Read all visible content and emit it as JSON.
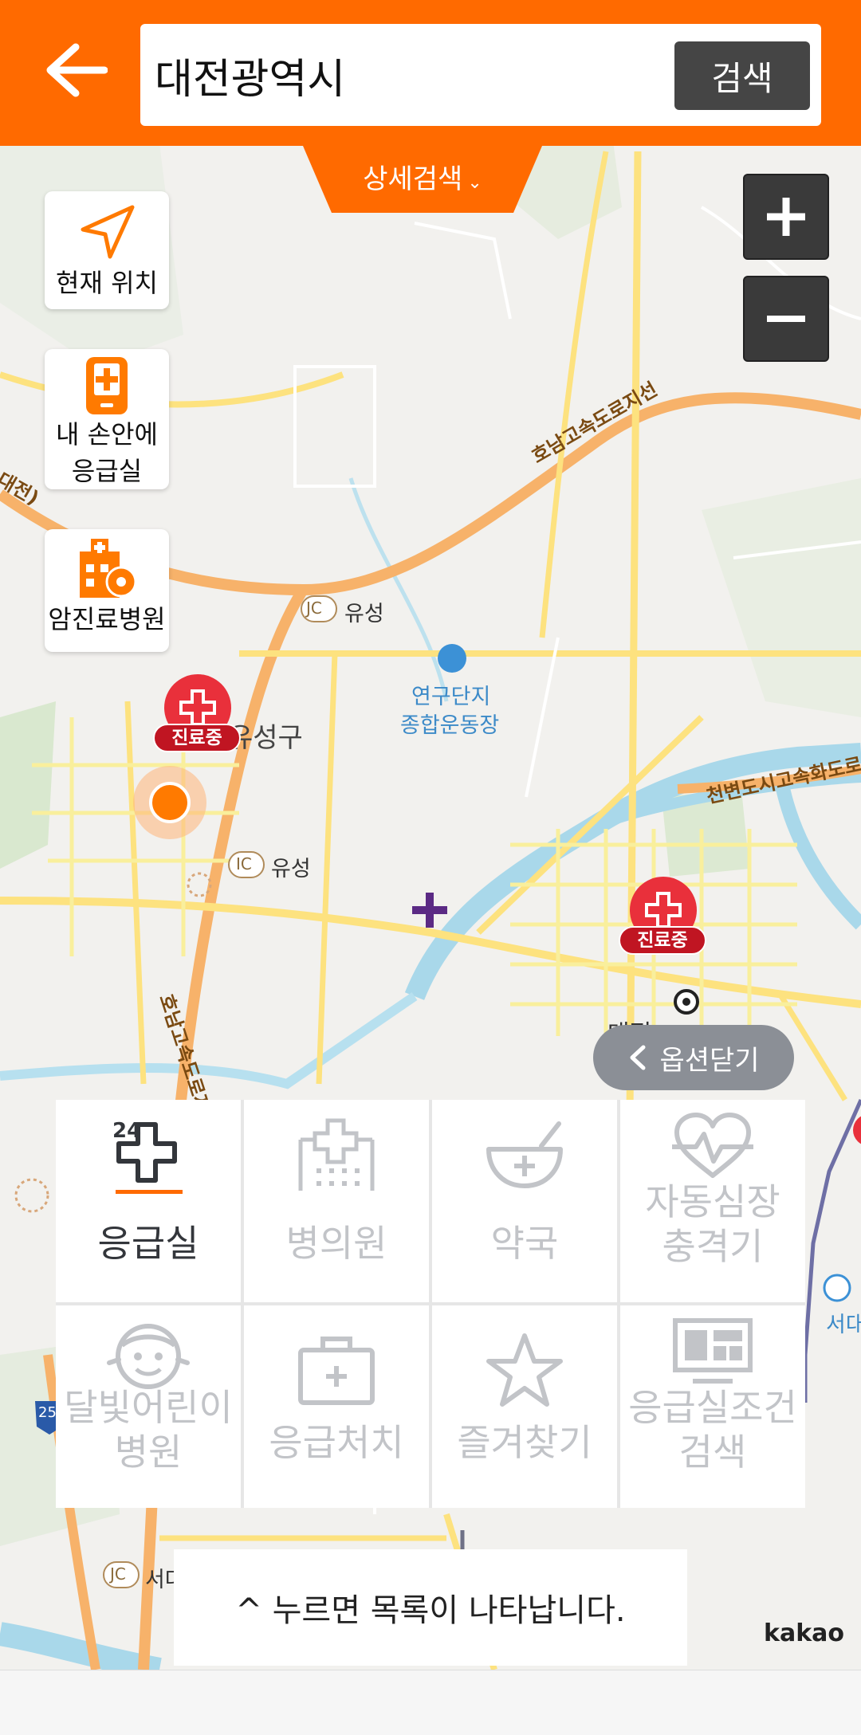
{
  "header": {
    "search_value": "대전광역시",
    "search_button": "검색",
    "detail_search": "상세검색"
  },
  "colors": {
    "brand": "#ff6a00",
    "marker": "#e9303b",
    "marker_badge": "#c01522",
    "grey_text": "#c2c4c8"
  },
  "left_buttons": {
    "current_location": "현재 위치",
    "er_in_hand_line1": "내 손안에",
    "er_in_hand_line2": "응급실",
    "cancer_hospital": "암진료병원"
  },
  "map_labels": {
    "jc_yuseong": "유성",
    "ic_yuseong": "유성",
    "yuseong_gu": "유성구",
    "sports_line1": "연구단지",
    "sports_line2": "종합운동장",
    "honam_branch": "호남고속도로지선",
    "cheonbyeon": "천변도시고속화도로",
    "honam_vertical": "호남고속도로지선",
    "left_edge": "대전)",
    "daejeon_station": "대전",
    "west_daejeon": "서대전",
    "jc_bottom": "서대",
    "jc_badge": "JC",
    "ic_badge": "IC",
    "highway_num": "25"
  },
  "markers": [
    {
      "status": "진료중"
    },
    {
      "status": "진료중"
    }
  ],
  "options_close": "옵션닫기",
  "categories": [
    {
      "label": "응급실",
      "active": true,
      "icon": "er-24-cross-icon"
    },
    {
      "label": "병의원",
      "active": false,
      "icon": "hospital-building-icon"
    },
    {
      "label": "약국",
      "active": false,
      "icon": "pharmacy-bowl-icon"
    },
    {
      "label_line1": "자동심장",
      "label_line2": "충격기",
      "active": false,
      "icon": "heart-pulse-icon"
    },
    {
      "label_line1": "달빛어린이",
      "label_line2": "병원",
      "active": false,
      "icon": "child-face-icon"
    },
    {
      "label": "응급처치",
      "active": false,
      "icon": "first-aid-kit-icon"
    },
    {
      "label": "즐겨찾기",
      "active": false,
      "icon": "star-icon"
    },
    {
      "label_line1": "응급실조건",
      "label_line2": "검색",
      "active": false,
      "icon": "monitor-icon"
    }
  ],
  "list_hint": "^ 누르면 목록이 나타납니다.",
  "map_attribution": "kakao"
}
